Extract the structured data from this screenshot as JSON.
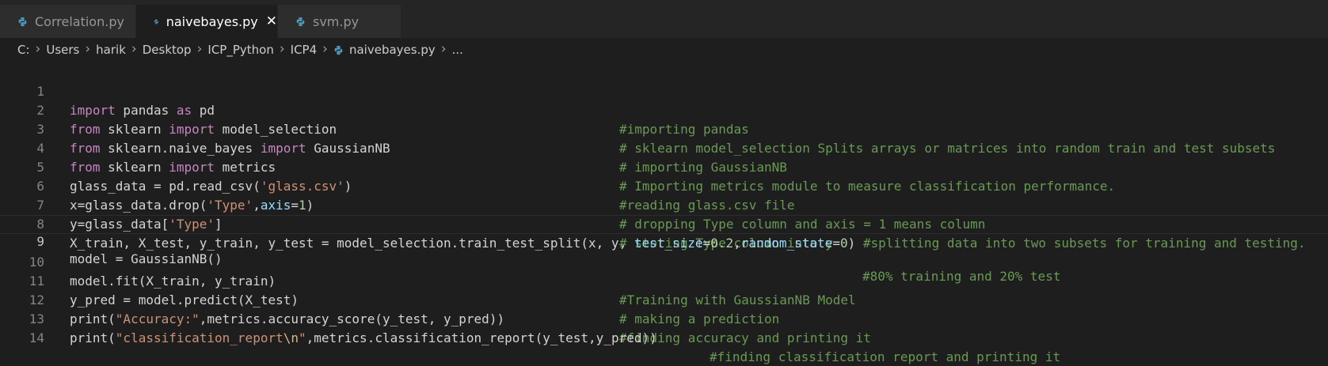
{
  "tabs": [
    {
      "label": "Correlation.py"
    },
    {
      "label": "naivebayes.py",
      "close": "✕"
    },
    {
      "label": "svm.py"
    }
  ],
  "breadcrumb": {
    "items": [
      "C:",
      "Users",
      "harik",
      "Desktop",
      "ICP_Python",
      "ICP4",
      "naivebayes.py",
      "..."
    ]
  },
  "editor": {
    "line_numbers": [
      "1",
      "2",
      "3",
      "4",
      "5",
      "6",
      "7",
      "8",
      "9",
      "10",
      "11",
      "12",
      "13",
      "14"
    ],
    "lines": {
      "l1": {
        "kw1": "import",
        "t1": " pandas ",
        "kw2": "as",
        "t2": " pd",
        "comment": "#importing pandas"
      },
      "l2": {
        "kw1": "from",
        "t1": " sklearn ",
        "kw2": "import",
        "t2": " model_selection",
        "comment": "# sklearn model_selection Splits arrays or matrices into random train and test subsets"
      },
      "l3": {
        "kw1": "from",
        "t1": " sklearn.naive_bayes ",
        "kw2": "import",
        "t2": " GaussianNB",
        "comment": "# importing GaussianNB"
      },
      "l4": {
        "kw1": "from",
        "t1": " sklearn ",
        "kw2": "import",
        "t2": " metrics",
        "comment": "# Importing metrics module to measure classification performance."
      },
      "l5": {
        "t1": "glass_data = pd.read_csv(",
        "s1": "'glass.csv'",
        "t2": ")",
        "comment": "#reading glass.csv file"
      },
      "l6": {
        "t1": "x=glass_data.drop(",
        "s1": "'Type'",
        "t2": ",",
        "p1": "axis",
        "t3": "=",
        "n1": "1",
        "t4": ")",
        "comment": "# dropping Type column and axis = 1 means column"
      },
      "l7": {
        "t1": "y=glass_data[",
        "s1": "'Type'",
        "t2": "]",
        "comment": "# storing Type column into y"
      },
      "l8": {
        "t1": "X_train, X_test, y_train, y_test = model_selection.train_test_split(x, y, ",
        "p1": "test_size",
        "t2": "=",
        "n1": "0.2",
        "t3": ",",
        "p2": "random_state",
        "t4": "=",
        "n2": "0",
        "t5": ")",
        "comment": " #splitting data into two subsets for training and testing."
      },
      "l9": {
        "t1": "model = GaussianNB()",
        "comment": "#80% training and 20% test"
      },
      "l10": {
        "t1": "model.fit(X_train, y_train)",
        "comment": "#Training with GaussianNB Model"
      },
      "l11": {
        "t1": "y_pred = model.predict(X_test)",
        "comment": "# making a prediction"
      },
      "l12": {
        "t1": "print(",
        "s1": "\"Accuracy:\"",
        "t2": ",metrics.accuracy_score(y_test, y_pred))",
        "comment": "#finding accuracy and printing it"
      },
      "l13": {
        "t1": "print(",
        "s1": "\"classification_report",
        "e1": "\\n",
        "s2": "\"",
        "t2": ",metrics.classification_report(y_test,y_pred))",
        "comment": "#finding classification report and printing it"
      }
    }
  },
  "colors": {
    "background": "#1e1e1e",
    "keyword": "#c586c0",
    "string": "#ce9178",
    "comment": "#6a9955",
    "number": "#b5cea8",
    "parameter": "#9cdcfe"
  },
  "icons": {
    "file": "python-file-icon",
    "close": "close-icon",
    "separator": "chevron-right-icon"
  }
}
